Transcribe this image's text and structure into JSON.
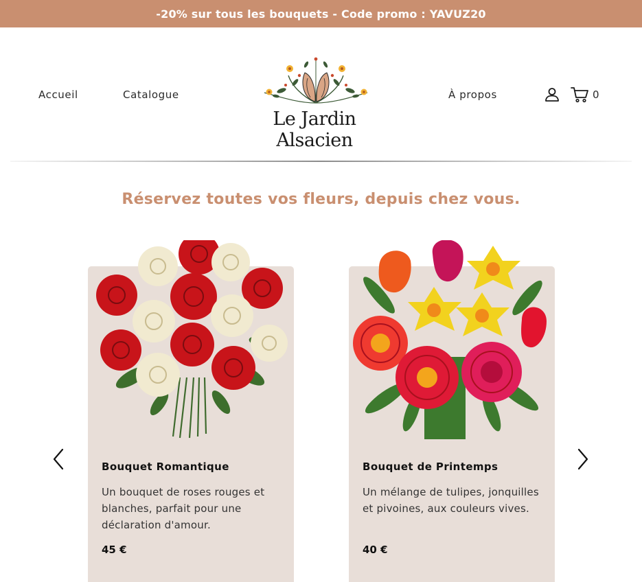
{
  "promo": {
    "text": "-20% sur tous les bouquets - Code promo : YAVUZ20"
  },
  "nav": {
    "home": "Accueil",
    "catalogue": "Catalogue",
    "about": "À propos"
  },
  "logo": {
    "text": "Le Jardin Alsacien"
  },
  "cart": {
    "count": "0"
  },
  "icons": {
    "account": "user-icon",
    "cart": "cart-icon",
    "prev": "chevron-left-icon",
    "next": "chevron-right-icon"
  },
  "tagline": "Réservez toutes vos fleurs, depuis chez vous.",
  "products": [
    {
      "name": "Bouquet Romantique",
      "description": "Un bouquet de roses rouges et blanches, parfait pour une déclaration d'amour.",
      "price": "45 €"
    },
    {
      "name": "Bouquet de Printemps",
      "description": "Un mélange de tulipes, jonquilles et pivoines, aux couleurs vives.",
      "price": "40 €"
    }
  ],
  "colors": {
    "promo_bg": "#c98f70",
    "accent": "#c98f70",
    "card_bg": "#e8ded8"
  }
}
